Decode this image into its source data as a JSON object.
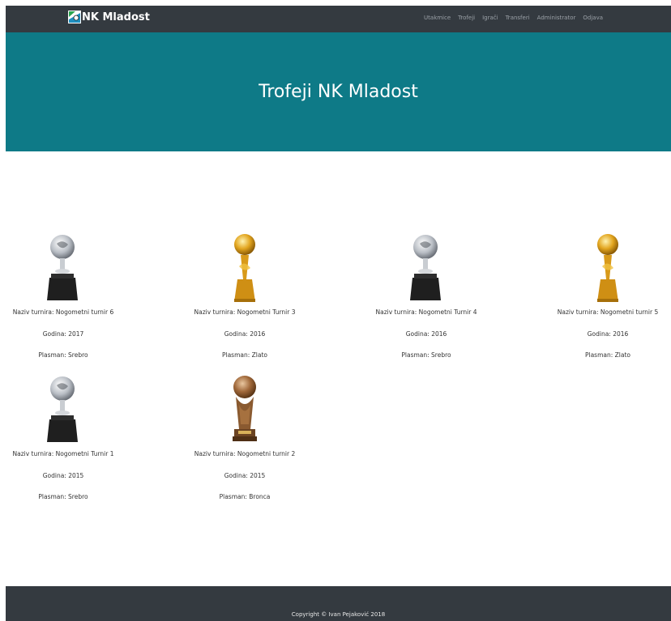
{
  "brand": {
    "name": "NK Mladost",
    "logo_icon": "club-logo-icon"
  },
  "nav": {
    "items": [
      {
        "label": "Utakmice"
      },
      {
        "label": "Trofeji"
      },
      {
        "label": "Igrači"
      },
      {
        "label": "Transferi"
      },
      {
        "label": "Administrator"
      },
      {
        "label": "Odjava"
      }
    ]
  },
  "hero": {
    "title": "Trofeji NK Mladost"
  },
  "trophies": [
    {
      "name": "Naziv turnira: Nogometni turnir 6",
      "year": "Godina: 2017",
      "placement": "Plasman: Srebro",
      "icon": "silver-trophy-icon"
    },
    {
      "name": "Naziv turnira: Nogometni Turnir 3",
      "year": "Godina: 2016",
      "placement": "Plasman: Zlato",
      "icon": "gold-trophy-icon"
    },
    {
      "name": "Naziv turnira: Nogometni Turnir 4",
      "year": "Godina: 2016",
      "placement": "Plasman: Srebro",
      "icon": "silver-trophy-icon"
    },
    {
      "name": "Naziv turnira: Nogometni turnir 5",
      "year": "Godina: 2016",
      "placement": "Plasman: Zlato",
      "icon": "gold-trophy-icon"
    },
    {
      "name": "Naziv turnira: Nogometni Turnir 1",
      "year": "Godina: 2015",
      "placement": "Plasman: Srebro",
      "icon": "silver-trophy-icon"
    },
    {
      "name": "Naziv turnira: Nogometni turnir 2",
      "year": "Godina: 2015",
      "placement": "Plasman: Bronca",
      "icon": "bronze-trophy-icon"
    }
  ],
  "footer": {
    "text": "Copyright © Ivan Pejaković 2018"
  },
  "colors": {
    "navbar": "#343a40",
    "hero": "#0e7a87",
    "footer": "#343a40"
  }
}
